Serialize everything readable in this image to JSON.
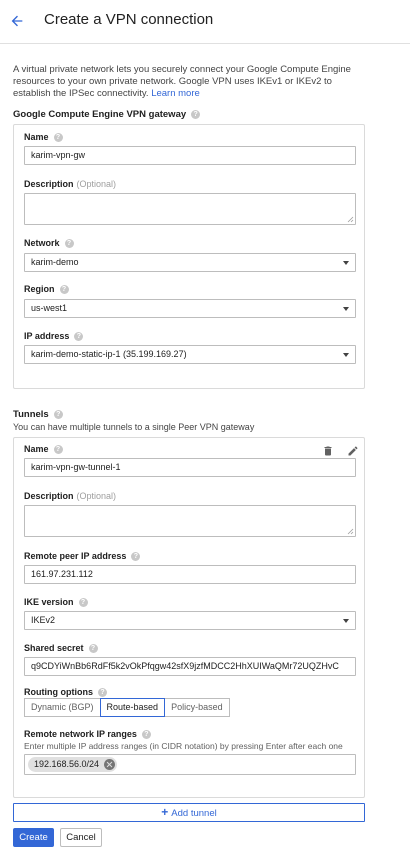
{
  "header": {
    "title": "Create a VPN connection",
    "back_icon": "arrow-back-icon"
  },
  "intro": {
    "text": "A virtual private network lets you securely connect your Google Compute Engine resources to your own private network. Google VPN uses IKEv1 or IKEv2 to establish the IPSec connectivity.",
    "link": "Learn more"
  },
  "gateway": {
    "title": "Google Compute Engine VPN gateway",
    "name_label": "Name",
    "name_value": "karim-vpn-gw",
    "description_label": "Description",
    "optional": "(Optional)",
    "network_label": "Network",
    "network_value": "karim-demo",
    "region_label": "Region",
    "region_value": "us-west1",
    "ip_label": "IP address",
    "ip_value": "karim-demo-static-ip-1 (35.199.169.27)"
  },
  "tunnels": {
    "title": "Tunnels",
    "subtitle": "You can have multiple tunnels to a single Peer VPN gateway",
    "name_label": "Name",
    "name_value": "karim-vpn-gw-tunnel-1",
    "description_label": "Description",
    "optional": "(Optional)",
    "peer_label": "Remote peer IP address",
    "peer_value": "161.97.231.112",
    "ike_label": "IKE version",
    "ike_value": "IKEv2",
    "secret_label": "Shared secret",
    "secret_value": "q9CDYiWnBb6RdFf5k2vOkPfqgw42sfX9jzfMDCC2HhXUIWaQMr72UQZHvC",
    "routing_label": "Routing options",
    "routing_options": [
      "Dynamic (BGP)",
      "Route-based",
      "Policy-based"
    ],
    "routing_selected": "Route-based",
    "ranges_label": "Remote network IP ranges",
    "ranges_hint": "Enter multiple IP address ranges (in CIDR notation) by pressing Enter after each one",
    "ranges": [
      "192.168.56.0/24"
    ]
  },
  "actions": {
    "add_tunnel": "Add tunnel",
    "create": "Create",
    "cancel": "Cancel"
  },
  "colors": {
    "accent": "#3367d6",
    "border": "#bdbdbd",
    "help": "#c8c8c8"
  }
}
